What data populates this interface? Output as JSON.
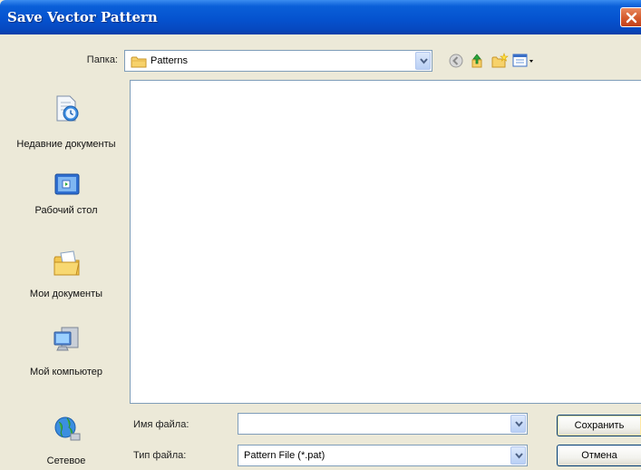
{
  "window": {
    "title": "Save Vector Pattern"
  },
  "lookin": {
    "label": "Папка:",
    "value": "Patterns"
  },
  "toolbar": {
    "icons": [
      "back-icon",
      "up-folder-icon",
      "new-folder-icon",
      "view-menu-icon"
    ]
  },
  "places": [
    {
      "label": "Недавние документы",
      "icon": "recent-documents-icon"
    },
    {
      "label": "Рабочий стол",
      "icon": "desktop-icon"
    },
    {
      "label": "Мои документы",
      "icon": "my-documents-icon"
    },
    {
      "label": "Мой компьютер",
      "icon": "my-computer-icon"
    },
    {
      "label": "Сетевое",
      "icon": "network-icon"
    }
  ],
  "filename": {
    "label": "Имя файла:",
    "value": ""
  },
  "filetype": {
    "label": "Тип файла:",
    "value": "Pattern File (*.pat)"
  },
  "buttons": {
    "save": "Сохранить",
    "cancel": "Отмена"
  },
  "colors": {
    "titlebar": "#0553cf",
    "close": "#d45a2c",
    "dialog_bg": "#ece9d8",
    "border": "#7f9db9"
  }
}
